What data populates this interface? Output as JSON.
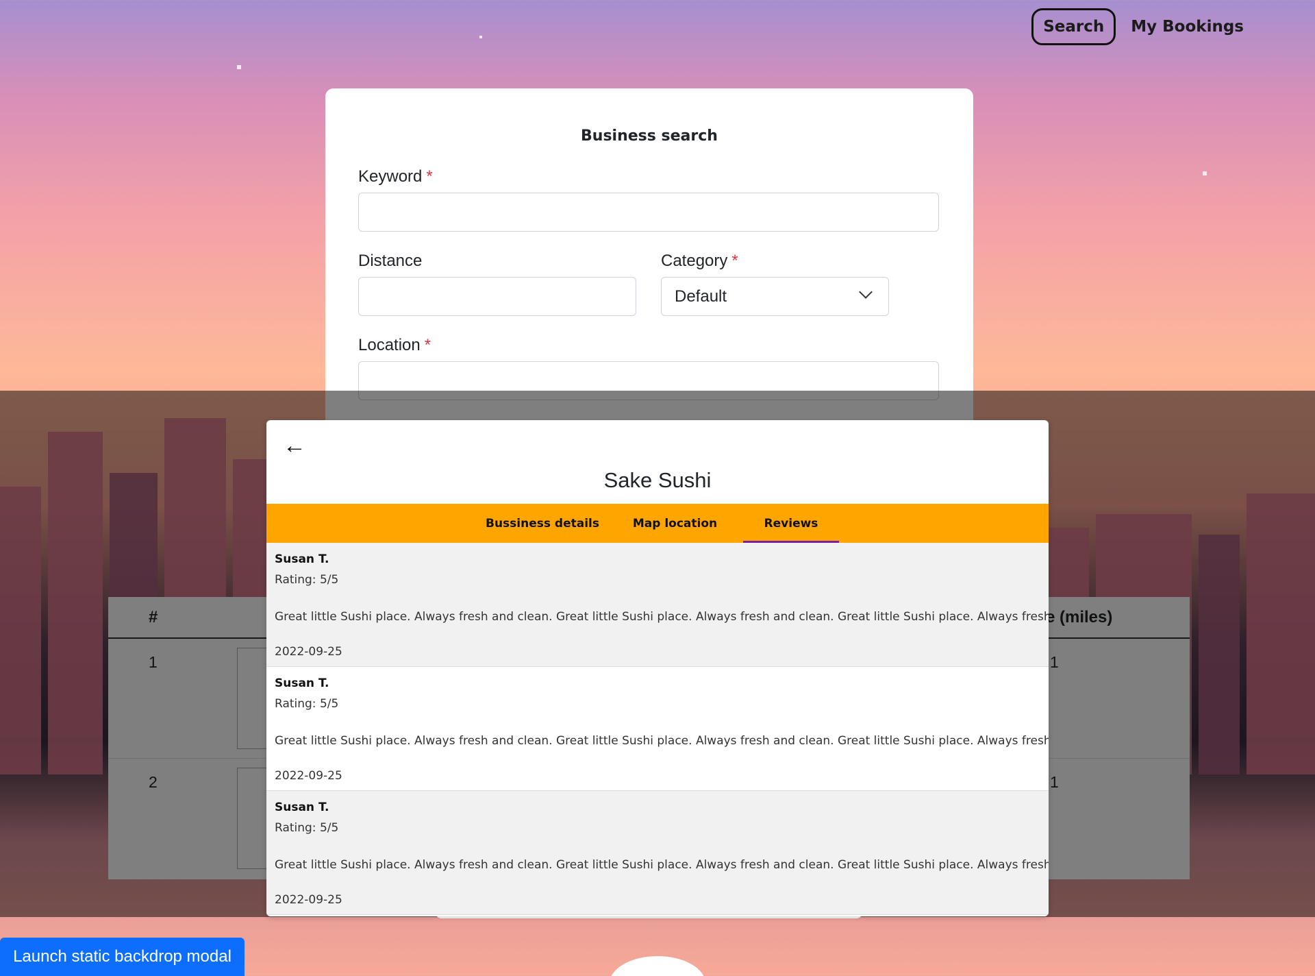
{
  "nav": {
    "search": "Search",
    "bookings": "My Bookings"
  },
  "form": {
    "title": "Business search",
    "keyword_label": "Keyword",
    "distance_label": "Distance",
    "category_label": "Category",
    "category_value": "Default",
    "location_label": "Location",
    "required_mark": "*"
  },
  "table": {
    "headers": {
      "index": "#",
      "distance_partial": "e (miles)"
    },
    "rows": [
      {
        "index": "1",
        "distance_partial": "1"
      },
      {
        "index": "2",
        "distance_partial": "1"
      }
    ]
  },
  "launch_button": "Launch static backdrop modal",
  "modal": {
    "back_icon": "←",
    "title": "Sake Sushi",
    "tabs": [
      "Bussiness details",
      "Map location",
      "Reviews"
    ],
    "active_tab": "Reviews",
    "reviews": [
      {
        "name": "Susan T.",
        "rating": "Rating: 5/5",
        "text": "Great little Sushi place. Always fresh and clean. Great little Sushi place. Always fresh and clean. Great little Sushi place. Always fresh and clean.",
        "date": "2022-09-25"
      },
      {
        "name": "Susan T.",
        "rating": "Rating: 5/5",
        "text": "Great little Sushi place. Always fresh and clean. Great little Sushi place. Always fresh and clean. Great little Sushi place. Always fresh and clean.",
        "date": "2022-09-25"
      },
      {
        "name": "Susan T.",
        "rating": "Rating: 5/5",
        "text": "Great little Sushi place. Always fresh and clean. Great little Sushi place. Always fresh and clean. Great little Sushi place. Always fresh and clean.",
        "date": "2022-09-25"
      }
    ]
  },
  "colors": {
    "tab_bar": "#ffa500",
    "active_tab_underline": "#7b1fa2",
    "launch_button": "#0d6efd",
    "required": "#dc3545"
  }
}
